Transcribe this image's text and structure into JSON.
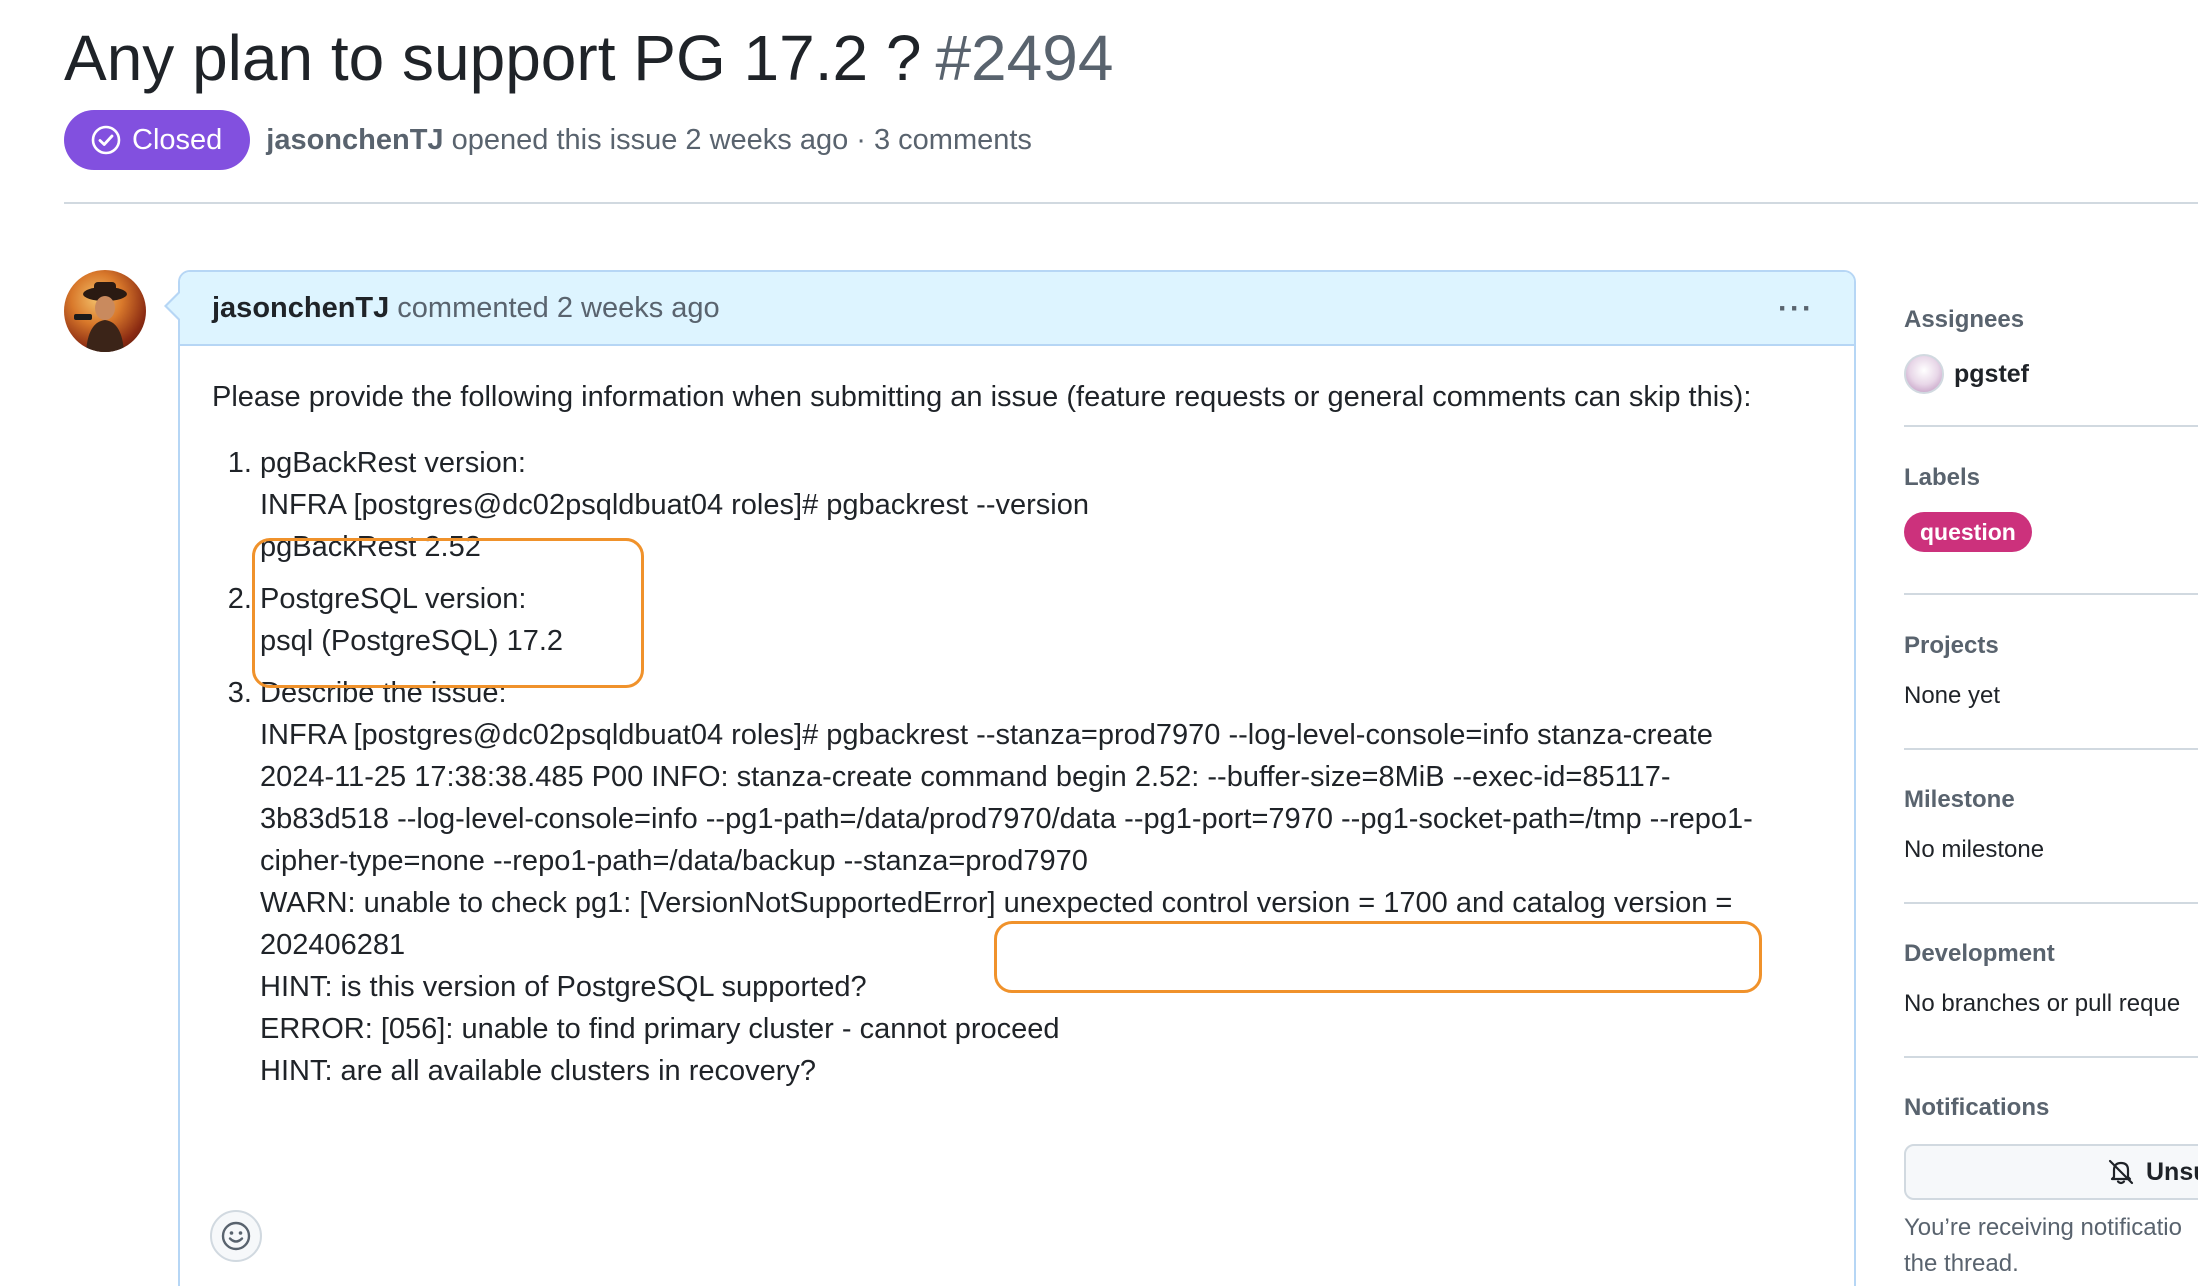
{
  "issue": {
    "title": "Any plan to support PG 17.2 ?",
    "number": "#2494",
    "state_label": "Closed",
    "state_color": "#8250df",
    "author": "jasonchenTJ",
    "opened_text": "opened this issue 2 weeks ago · 3 comments"
  },
  "comment": {
    "author": "jasonchenTJ",
    "action_text": "commented 2 weeks ago",
    "menu_label": "···",
    "intro": "Please provide the following information when submitting an issue (feature requests or general comments can skip this):",
    "items": [
      {
        "lines": [
          "pgBackRest version:",
          "INFRA [postgres@dc02psqldbuat04 roles]# pgbackrest --version",
          "pgBackRest 2.52"
        ]
      },
      {
        "lines": [
          "PostgreSQL version:",
          "psql (PostgreSQL) 17.2"
        ]
      },
      {
        "lines": [
          "Describe the issue:",
          "INFRA [postgres@dc02psqldbuat04 roles]# pgbackrest --stanza=prod7970 --log-level-console=info stanza-create",
          "2024-11-25 17:38:38.485 P00 INFO: stanza-create command begin 2.52: --buffer-size=8MiB --exec-id=85117-",
          "3b83d518 --log-level-console=info --pg1-path=/data/prod7970/data --pg1-port=7970 --pg1-socket-path=/tmp --repo1-",
          "cipher-type=none --repo1-path=/data/backup --stanza=prod7970",
          "WARN: unable to check pg1: [VersionNotSupportedError] unexpected control version = 1700 and catalog version =",
          "202406281",
          "HINT: is this version of PostgreSQL supported?",
          "ERROR: [056]: unable to find primary cluster - cannot proceed",
          "HINT: are all available clusters in recovery?"
        ]
      }
    ],
    "highlight_color": "#f0922b"
  },
  "sidebar": {
    "assignees_title": "Assignees",
    "assignee_name": "pgstef",
    "labels_title": "Labels",
    "label_name": "question",
    "label_color": "#cc317c",
    "projects_title": "Projects",
    "projects_value": "None yet",
    "milestone_title": "Milestone",
    "milestone_value": "No milestone",
    "development_title": "Development",
    "development_value": "No branches or pull reque",
    "notifications_title": "Notifications",
    "notifications_button": "Unsu",
    "notifications_note_1": "You’re receiving notificatio",
    "notifications_note_2": "the thread."
  }
}
